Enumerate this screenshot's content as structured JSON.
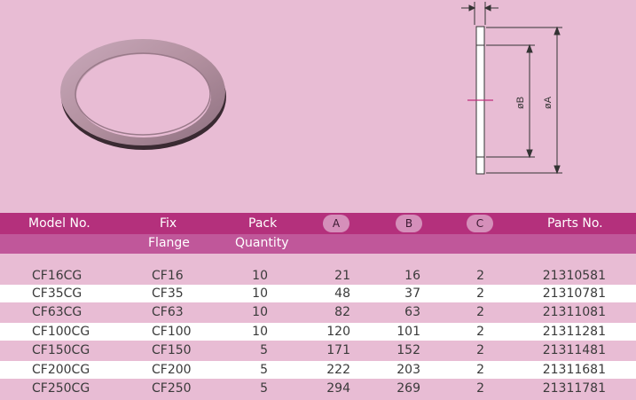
{
  "diagram": {
    "dimension_a": "øA",
    "dimension_b": "øB"
  },
  "table": {
    "headers": {
      "model": "Model No.",
      "fix_line1": "Fix",
      "fix_line2": "Flange",
      "pack_line1": "Pack",
      "pack_line2": "Quantity",
      "a": "A",
      "b": "B",
      "c": "C",
      "parts": "Parts No."
    },
    "rows": [
      {
        "model": "CF16CG",
        "flange": "CF16",
        "qty": "10",
        "a": "21",
        "b": "16",
        "c": "2",
        "parts": "21310581"
      },
      {
        "model": "CF35CG",
        "flange": "CF35",
        "qty": "10",
        "a": "48",
        "b": "37",
        "c": "2",
        "parts": "21310781"
      },
      {
        "model": "CF63CG",
        "flange": "CF63",
        "qty": "10",
        "a": "82",
        "b": "63",
        "c": "2",
        "parts": "21311081"
      },
      {
        "model": "CF100CG",
        "flange": "CF100",
        "qty": "10",
        "a": "120",
        "b": "101",
        "c": "2",
        "parts": "21311281"
      },
      {
        "model": "CF150CG",
        "flange": "CF150",
        "qty": "5",
        "a": "171",
        "b": "152",
        "c": "2",
        "parts": "21311481"
      },
      {
        "model": "CF200CG",
        "flange": "CF200",
        "qty": "5",
        "a": "222",
        "b": "203",
        "c": "2",
        "parts": "21311681"
      },
      {
        "model": "CF250CG",
        "flange": "CF250",
        "qty": "5",
        "a": "294",
        "b": "269",
        "c": "2",
        "parts": "21311781"
      }
    ]
  }
}
